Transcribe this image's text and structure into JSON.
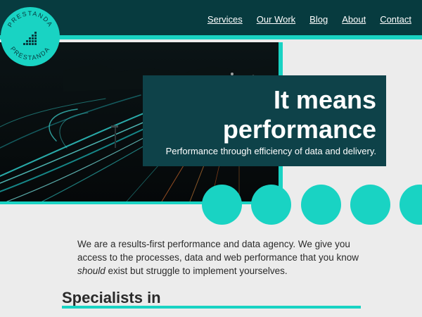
{
  "brand": {
    "name": "PRESTANDA",
    "colors": {
      "primary_dark": "#073b3f",
      "accent": "#19d3c3",
      "card": "#0e4249",
      "background": "#ececec"
    }
  },
  "nav": {
    "items": [
      {
        "label": "Services"
      },
      {
        "label": "Our Work"
      },
      {
        "label": "Blog"
      },
      {
        "label": "About"
      },
      {
        "label": "Contact"
      }
    ]
  },
  "hero": {
    "title_line1": "It means",
    "title_line2": "performance",
    "subtitle": "Performance through efficiency of data and delivery.",
    "image": "night-highway-light-trails"
  },
  "intro": {
    "text_before": "We are a results-first performance and data agency. We give you access to the processes, data and web performance that you know ",
    "emphasis": "should",
    "text_after": " exist but struggle to implement yourselves."
  },
  "section": {
    "title": "Specialists in"
  }
}
